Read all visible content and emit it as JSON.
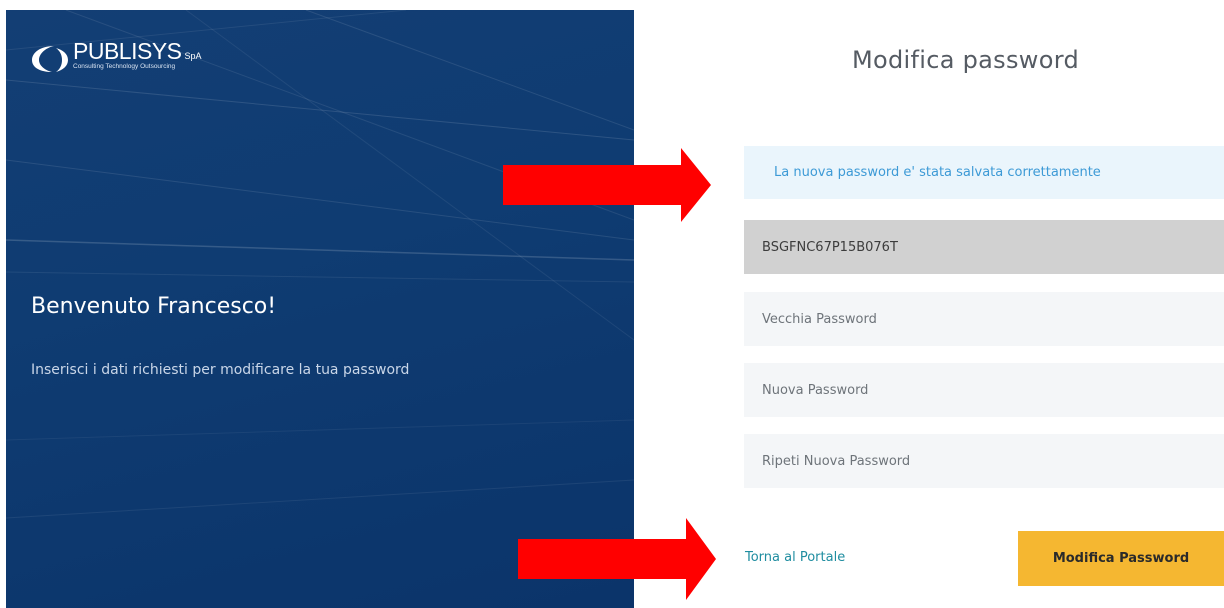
{
  "brand": {
    "name": "PUBLISYS",
    "suffix": "SpA",
    "tagline": "Consulting Technology Outsourcing"
  },
  "left_panel": {
    "title": "Benvenuto Francesco!",
    "subtitle": "Inserisci i dati richiesti per modificare la tua password"
  },
  "form": {
    "title": "Modifica password",
    "success_message": "La nuova password e' stata salvata correttamente",
    "username_value": "BSGFNC67P15B076T",
    "old_password_placeholder": "Vecchia Password",
    "new_password_placeholder": "Nuova Password",
    "repeat_password_placeholder": "Ripeti Nuova Password",
    "back_link": "Torna al Portale",
    "submit_label": "Modifica Password"
  },
  "colors": {
    "panel_blue": "#0f3c72",
    "accent_yellow": "#f5b731",
    "link_teal": "#1f8da0",
    "alert_text": "#3d9ad6",
    "arrow_red": "#ff0000"
  }
}
